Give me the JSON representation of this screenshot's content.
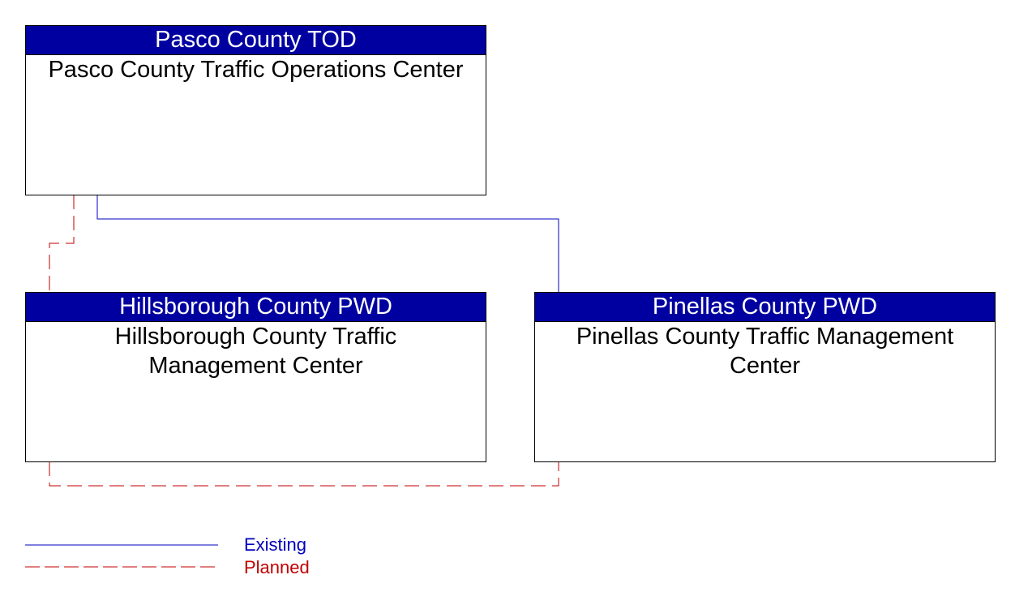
{
  "elements": [
    {
      "header": "Pasco County TOD",
      "name": "Pasco County Traffic Operations Center"
    },
    {
      "header": "Hillsborough County PWD",
      "name": "Hillsborough County Traffic Management Center"
    },
    {
      "header": "Pinellas County PWD",
      "name": "Pinellas County Traffic Management Center"
    }
  ],
  "connections": [
    {
      "from": "Pasco County TOD",
      "to": "Pinellas County PWD",
      "status": "Existing"
    },
    {
      "from": "Pasco County TOD",
      "to": "Hillsborough County PWD",
      "status": "Planned"
    },
    {
      "from": "Hillsborough County PWD",
      "to": "Pinellas County PWD",
      "status": "Planned"
    }
  ],
  "legend": {
    "existing": "Existing",
    "planned": "Planned"
  },
  "colors": {
    "header": "#0000a0",
    "existing": "#0000c0",
    "planned": "#c00000"
  }
}
